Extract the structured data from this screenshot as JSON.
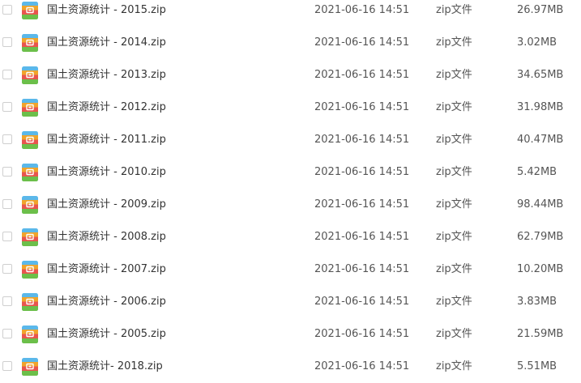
{
  "files": [
    {
      "name": "国土资源统计 - 2015.zip",
      "modified": "2021-06-16 14:51",
      "type": "zip文件",
      "size": "26.97MB"
    },
    {
      "name": "国土资源统计 - 2014.zip",
      "modified": "2021-06-16 14:51",
      "type": "zip文件",
      "size": "3.02MB"
    },
    {
      "name": "国土资源统计 - 2013.zip",
      "modified": "2021-06-16 14:51",
      "type": "zip文件",
      "size": "34.65MB"
    },
    {
      "name": "国土资源统计 - 2012.zip",
      "modified": "2021-06-16 14:51",
      "type": "zip文件",
      "size": "31.98MB"
    },
    {
      "name": "国土资源统计 - 2011.zip",
      "modified": "2021-06-16 14:51",
      "type": "zip文件",
      "size": "40.47MB"
    },
    {
      "name": "国土资源统计 - 2010.zip",
      "modified": "2021-06-16 14:51",
      "type": "zip文件",
      "size": "5.42MB"
    },
    {
      "name": "国土资源统计 - 2009.zip",
      "modified": "2021-06-16 14:51",
      "type": "zip文件",
      "size": "98.44MB"
    },
    {
      "name": "国土资源统计 - 2008.zip",
      "modified": "2021-06-16 14:51",
      "type": "zip文件",
      "size": "62.79MB"
    },
    {
      "name": "国土资源统计 - 2007.zip",
      "modified": "2021-06-16 14:51",
      "type": "zip文件",
      "size": "10.20MB"
    },
    {
      "name": "国土资源统计 - 2006.zip",
      "modified": "2021-06-16 14:51",
      "type": "zip文件",
      "size": "3.83MB"
    },
    {
      "name": "国土资源统计 - 2005.zip",
      "modified": "2021-06-16 14:51",
      "type": "zip文件",
      "size": "21.59MB"
    },
    {
      "name": "国土资源统计- 2018.zip",
      "modified": "2021-06-16 14:51",
      "type": "zip文件",
      "size": "5.51MB"
    }
  ],
  "icon": {
    "name": "zip-archive-icon",
    "colors": {
      "top": "#5bb8ea",
      "upper": "#f0a42b",
      "middle": "#e8554e",
      "lower": "#6cbf4a",
      "clasp": "#ffffff"
    }
  }
}
